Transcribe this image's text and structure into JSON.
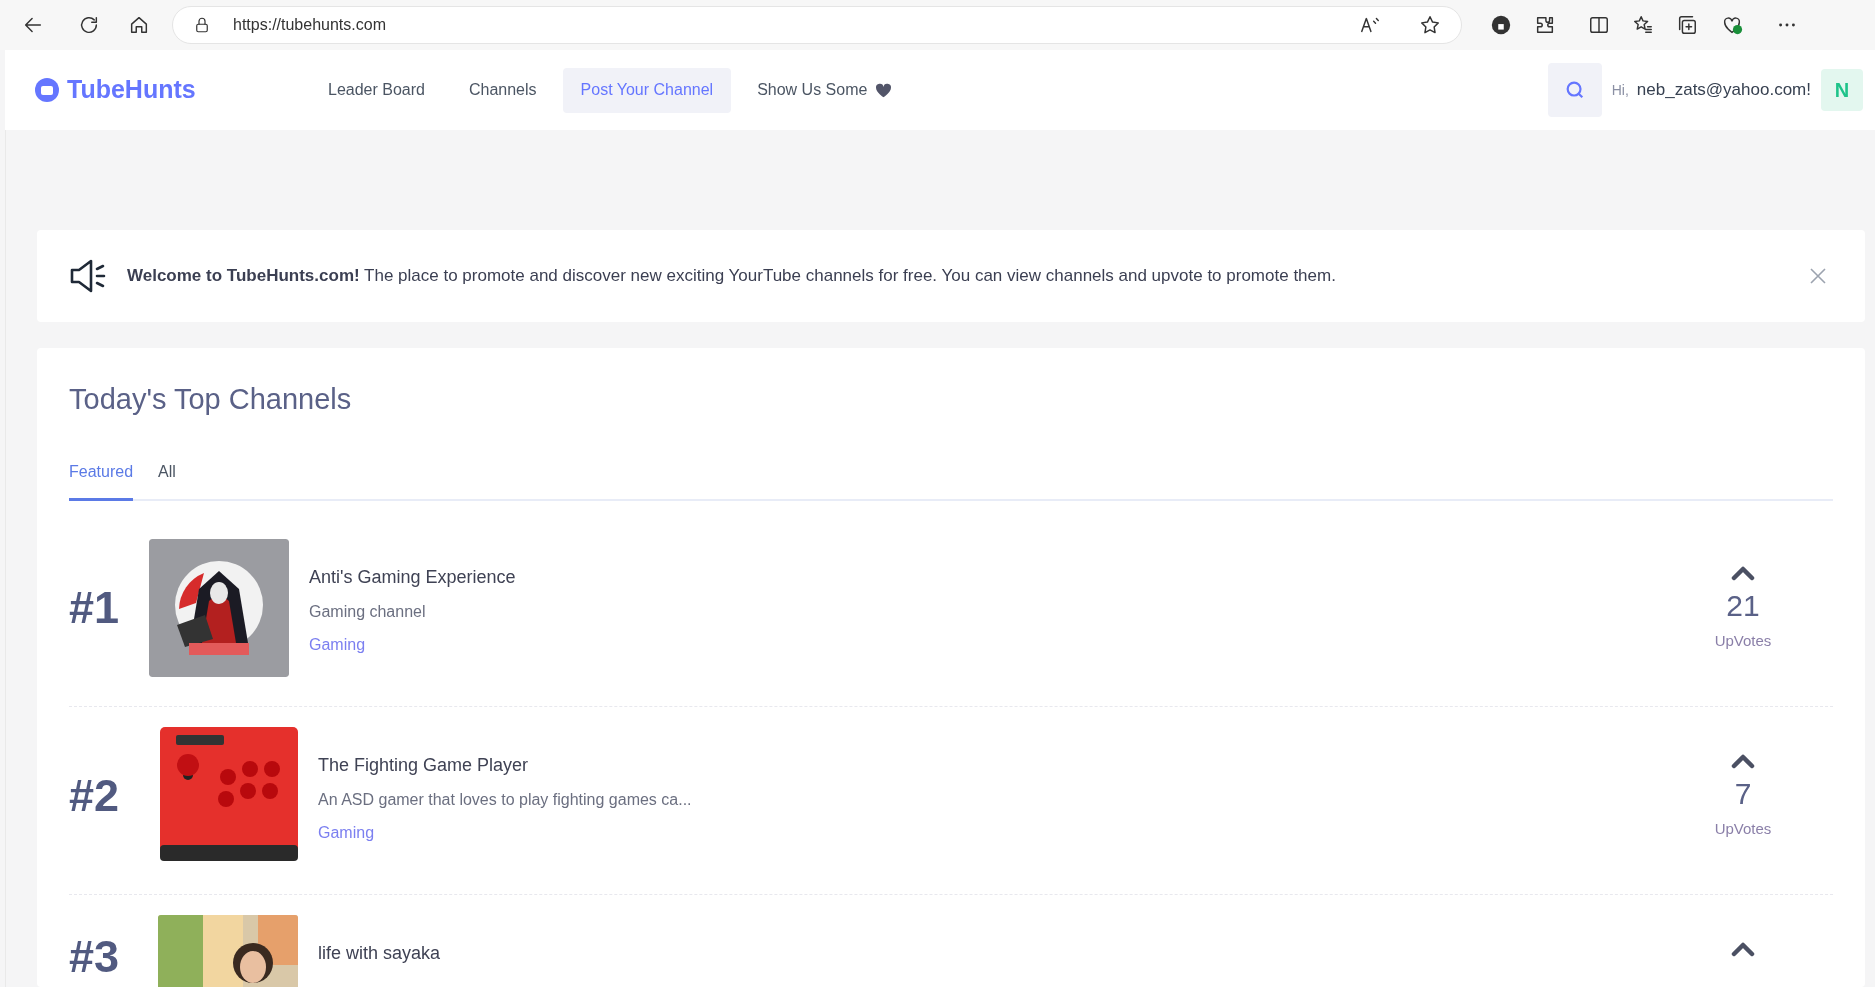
{
  "browser": {
    "url": "https://tubehunts.com"
  },
  "site": {
    "logo": "TubeHunts",
    "nav": [
      {
        "label": "Leader Board",
        "selected": false
      },
      {
        "label": "Channels",
        "selected": false
      },
      {
        "label": "Post Your Channel",
        "selected": true
      },
      {
        "label": "Show Us Some",
        "selected": false,
        "heart": true
      }
    ],
    "greeting": "Hi,",
    "user": "neb_zats@yahoo.com!",
    "avatar": "N"
  },
  "banner": {
    "text": "**Welcome to TubeHunts.com!** The place to promote and discover new exciting YourTube channels for free. You can view channels and upvote to promote them."
  },
  "section": {
    "title": "Today's Top Channels",
    "tabs": [
      {
        "label": "Featured",
        "selected": true
      },
      {
        "label": "All",
        "selected": false
      }
    ],
    "rows": [
      {
        "rank": "#1",
        "title": "Anti's Gaming Experience",
        "description": "Gaming channel",
        "category": "Gaming",
        "votes": "21",
        "votes_label": "UpVotes"
      },
      {
        "rank": "#2",
        "title": "The Fighting Game Player",
        "description": "An ASD gamer that loves to play fighting games ca...",
        "category": "Gaming",
        "votes": "7",
        "votes_label": "UpVotes"
      },
      {
        "rank": "#3",
        "title": "life with sayaka"
      }
    ]
  }
}
